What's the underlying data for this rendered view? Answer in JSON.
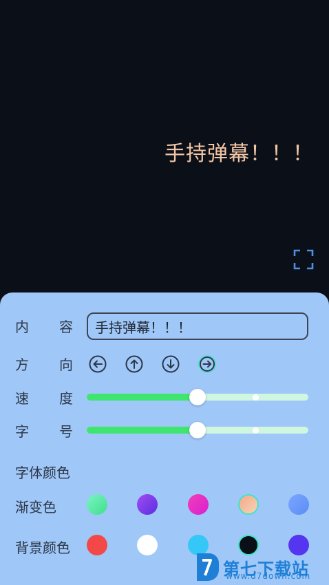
{
  "preview": {
    "danmaku_text": "手持弹幕！！！",
    "danmaku_color": "#f2c6a6",
    "background_color": "#0b0f18",
    "fullscreen_icon": "fullscreen-icon"
  },
  "panel": {
    "content": {
      "label_chars": [
        "内",
        "容"
      ],
      "value": "手持弹幕！！！"
    },
    "direction": {
      "label_chars": [
        "方",
        "向"
      ],
      "options": [
        {
          "icon": "arrow-left-icon",
          "selected": false
        },
        {
          "icon": "arrow-up-icon",
          "selected": false
        },
        {
          "icon": "arrow-down-icon",
          "selected": false
        },
        {
          "icon": "arrow-right-icon",
          "selected": true
        }
      ]
    },
    "speed": {
      "label_chars": [
        "速",
        "度"
      ],
      "value": 0.5,
      "secondary": 0.76
    },
    "font_size": {
      "label_chars": [
        "字",
        "号"
      ],
      "value": 0.5,
      "secondary": 0.76
    },
    "font_color_label": "字体颜色",
    "gradient": {
      "label": "渐变色",
      "swatches": [
        {
          "from": "#7cf2c6",
          "to": "#3fe08a",
          "selected": false
        },
        {
          "from": "#a04df2",
          "to": "#5b2ee0",
          "selected": false
        },
        {
          "from": "#f23fb8",
          "to": "#d81fd0",
          "selected": false
        },
        {
          "from": "#f6a88a",
          "to": "#f7d3b6",
          "selected": true
        },
        {
          "from": "#7aa7ff",
          "to": "#5c8cf5",
          "selected": false
        }
      ]
    },
    "background": {
      "label": "背景颜色",
      "swatches": [
        {
          "color": "#f24848",
          "selected": false
        },
        {
          "color": "#ffffff",
          "selected": false
        },
        {
          "color": "#35c7f5",
          "selected": false
        },
        {
          "color": "#0b0f18",
          "selected": true
        },
        {
          "color": "#5535f0",
          "selected": false
        }
      ]
    }
  },
  "watermark": {
    "text": "第七下载站",
    "url": "www.d7down.com"
  }
}
